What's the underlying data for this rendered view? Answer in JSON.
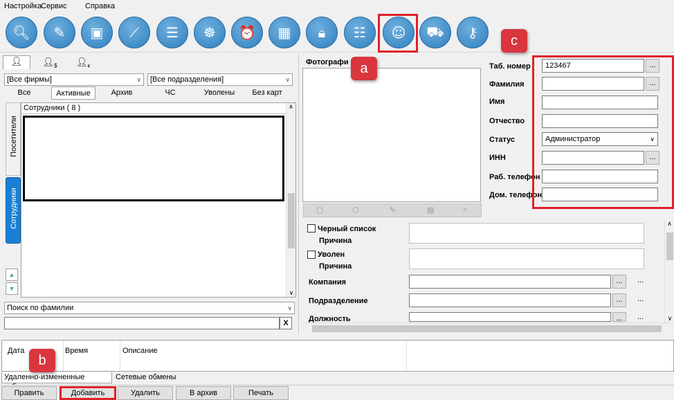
{
  "menu": [
    "Настройка",
    "Сервис",
    "Справка"
  ],
  "toolbar_icons": [
    "search-icon",
    "pencil-document-icon",
    "device-icon",
    "barrier-icon",
    "document-list-icon",
    "wheel-icon",
    "alarm-clock-icon",
    "photo-grid-icon",
    "lock-icon",
    "id-card-icon",
    "employees-icon",
    "car-icon",
    "key-icon"
  ],
  "left": {
    "firm_combo": "[Все фирмы]",
    "department_combo": "[Все подразделения]",
    "filter_tabs": [
      "Все",
      "Активные",
      "Архив",
      "ЧС",
      "Уволены",
      "Без карт"
    ],
    "vertical_tabs": [
      "Посетители",
      "Сотрудники"
    ],
    "list_header": "Сотрудники  ( 8 )",
    "search_combo": "Поиск по фамилии",
    "search_clear": "X"
  },
  "photo": {
    "label": "Фотографи"
  },
  "form": {
    "tab_number_label": "Таб. номер",
    "tab_number_value": "123467",
    "surname_label": "Фамилия",
    "name_label": "Имя",
    "patronymic_label": "Отчество",
    "status_label": "Статус",
    "status_value": "Администратор",
    "inn_label": "ИНН",
    "work_phone_label": "Раб. телефон",
    "home_phone_label": "Дом. телефон",
    "ellipsis": "...",
    "blacklist_label": "Черный список",
    "reason_label": "Причина",
    "dismissed_label": "Уволен",
    "company_label": "Компания",
    "department_label": "Подразделение",
    "position_label": "Должность"
  },
  "log": {
    "columns": [
      "Дата",
      "Время",
      "Описание"
    ],
    "tabs": [
      "Удаленно-измененные таблицы",
      "Сетевые обмены"
    ]
  },
  "bottom_buttons": [
    "Править",
    "Добавить",
    "Удалить",
    "В архив",
    "Печать"
  ],
  "callouts": [
    "a",
    "b",
    "c"
  ],
  "accent_red": "#e0202a",
  "callout_red": "#d9363e"
}
